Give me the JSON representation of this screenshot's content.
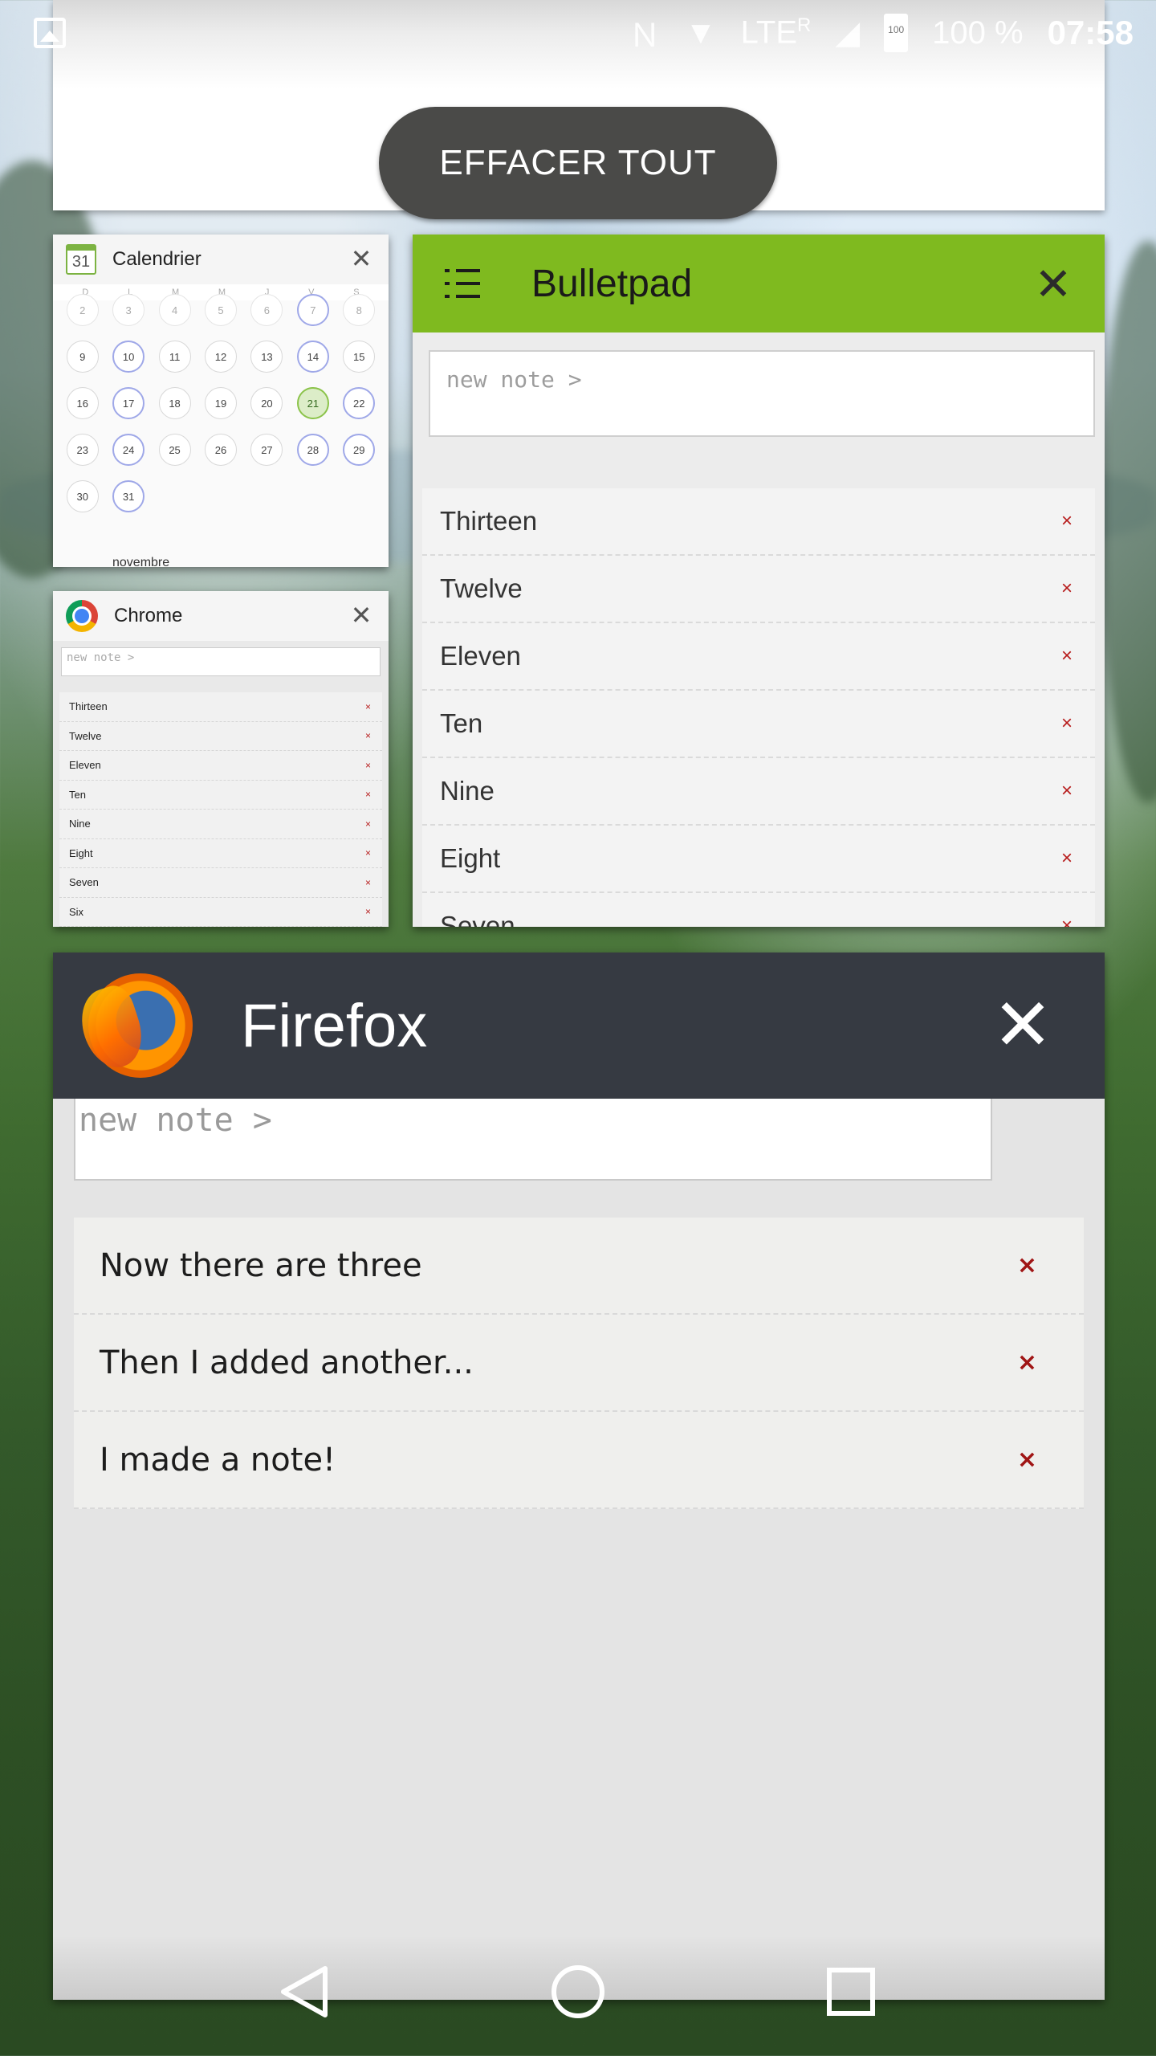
{
  "status_bar": {
    "network": "LTE",
    "roaming": "R",
    "battery_icon_text": "100",
    "battery_percent": "100 %",
    "time": "07:58"
  },
  "clear_all": {
    "label": "EFFACER TOUT"
  },
  "calendar_card": {
    "title": "Calendrier",
    "icon_day": "31",
    "weekdays": [
      "D",
      "L",
      "M",
      "M",
      "J",
      "V",
      "S"
    ],
    "days": [
      "2",
      "3",
      "4",
      "5",
      "6",
      "7",
      "8",
      "9",
      "10",
      "11",
      "12",
      "13",
      "14",
      "15",
      "16",
      "17",
      "18",
      "19",
      "20",
      "21",
      "22",
      "23",
      "24",
      "25",
      "26",
      "27",
      "28",
      "29",
      "30",
      "31"
    ],
    "today": "21",
    "footer_month": "novembre"
  },
  "chrome_card": {
    "title": "Chrome",
    "input_placeholder": "new note >",
    "items": [
      "Thirteen",
      "Twelve",
      "Eleven",
      "Ten",
      "Nine",
      "Eight",
      "Seven",
      "Six"
    ],
    "delete_symbol": "×"
  },
  "bulletpad_card": {
    "title": "Bulletpad",
    "input_placeholder": "new note >",
    "items": [
      "Thirteen",
      "Twelve",
      "Eleven",
      "Ten",
      "Nine",
      "Eight",
      "Seven"
    ],
    "delete_symbol": "×",
    "accent_color": "#7fba1f"
  },
  "firefox_card": {
    "title": "Firefox",
    "input_placeholder": "new note >",
    "items": [
      "Now there are three",
      "Then I added another...",
      "I made a note!"
    ],
    "delete_symbol": "×",
    "header_color": "#363a42"
  },
  "nav": {
    "back_icon": "triangle-back-icon",
    "home_icon": "circle-home-icon",
    "recents_icon": "square-recents-icon"
  }
}
